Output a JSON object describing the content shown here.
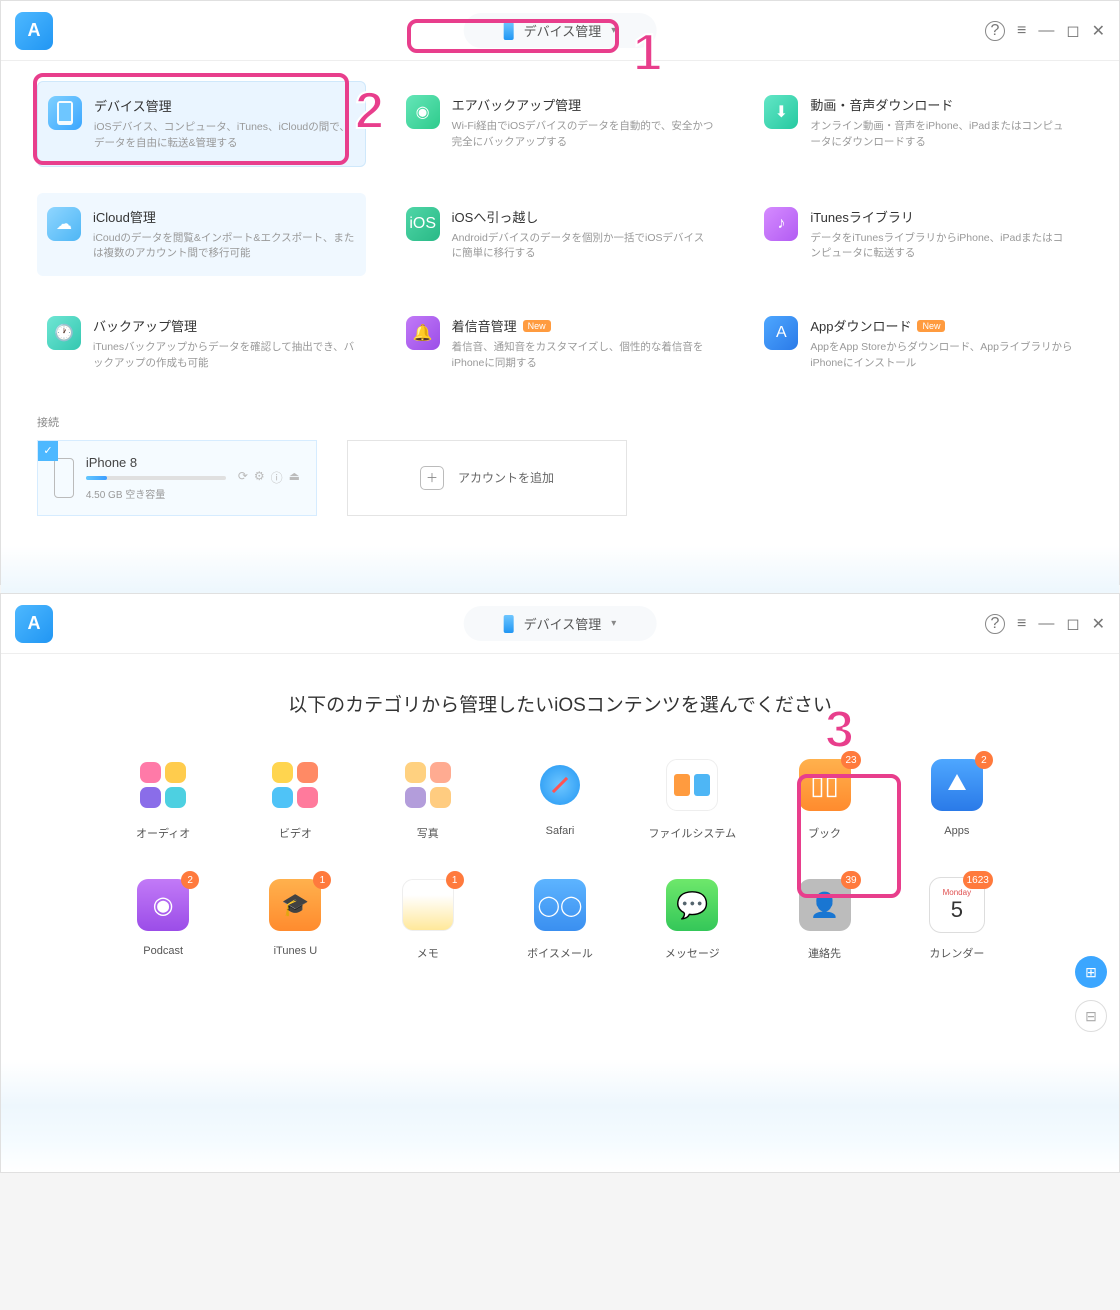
{
  "header": {
    "dropdown_label": "デバイス管理"
  },
  "features": [
    {
      "title": "デバイス管理",
      "desc": "iOSデバイス、コンピュータ、iTunes、iCloudの間で、データを自由に転送&管理する",
      "icon": "phone",
      "color": "linear-gradient(135deg,#7fd0ff,#3ba6ff)",
      "state": "selected"
    },
    {
      "title": "エアバックアップ管理",
      "desc": "Wi-Fi経由でiOSデバイスのデータを自動的で、安全かつ完全にバックアップする",
      "icon": "wifi",
      "color": "linear-gradient(135deg,#65e6b8,#2ecb8c)"
    },
    {
      "title": "動画・音声ダウンロード",
      "desc": "オンライン動画・音声をiPhone、iPadまたはコンピュータにダウンロードする",
      "icon": "download",
      "color": "linear-gradient(135deg,#63e6c6,#25c9a0)"
    },
    {
      "title": "iCloud管理",
      "desc": "iCoudのデータを閲覧&インポート&エクスポート、または複数のアカウント間で移行可能",
      "icon": "cloud",
      "color": "linear-gradient(135deg,#8fd6ff,#4eb6f5)",
      "state": "hover"
    },
    {
      "title": "iOSへ引っ越し",
      "desc": "Androidデバイスのデータを個別か一括でiOSデバイスに簡単に移行する",
      "icon": "ios",
      "color": "linear-gradient(135deg,#4fd6a7,#29b986)"
    },
    {
      "title": "iTunesライブラリ",
      "desc": "データをiTunesライブラリからiPhone、iPadまたはコンピュータに転送する",
      "icon": "music",
      "color": "linear-gradient(135deg,#d58bff,#b25cf3)"
    },
    {
      "title": "バックアップ管理",
      "desc": "iTunesバックアップからデータを確認して抽出でき、バックアップの作成も可能",
      "icon": "clock",
      "color": "linear-gradient(135deg,#6fe6d4,#34c7b0)"
    },
    {
      "title": "着信音管理",
      "desc": "着信音、通知音をカスタマイズし、個性的な着信音をiPhoneに同期する",
      "icon": "bell",
      "color": "linear-gradient(135deg,#c27af7,#9b4de8)",
      "badge": "New"
    },
    {
      "title": "Appダウンロード",
      "desc": "AppをApp Storeからダウンロード、AppライブラリからiPhoneにインストール",
      "icon": "appstore",
      "color": "linear-gradient(135deg,#4ea7ff,#2a7ae8)",
      "badge": "New"
    }
  ],
  "connect_label": "接続",
  "device": {
    "name": "iPhone 8",
    "storage": "4.50 GB 空き容量",
    "fill": 15
  },
  "add_account": "アカウントを追加",
  "window2": {
    "prompt": "以下のカテゴリから管理したいiOSコンテンツを選んでください",
    "categories": [
      {
        "name": "オーディオ",
        "icon": "audio"
      },
      {
        "name": "ビデオ",
        "icon": "video"
      },
      {
        "name": "写真",
        "icon": "photos"
      },
      {
        "name": "Safari",
        "icon": "safari"
      },
      {
        "name": "ファイルシステム",
        "icon": "files"
      },
      {
        "name": "ブック",
        "icon": "books",
        "badge": "23"
      },
      {
        "name": "Apps",
        "icon": "apps",
        "badge": "2",
        "highlight": true
      },
      {
        "name": "Podcast",
        "icon": "podcast",
        "badge": "2"
      },
      {
        "name": "iTunes U",
        "icon": "itunesu",
        "badge": "1"
      },
      {
        "name": "メモ",
        "icon": "notes",
        "badge": "1"
      },
      {
        "name": "ボイスメール",
        "icon": "voicemail"
      },
      {
        "name": "メッセージ",
        "icon": "messages"
      },
      {
        "name": "連絡先",
        "icon": "contacts",
        "badge": "39"
      },
      {
        "name": "カレンダー",
        "icon": "calendar",
        "badge": "1623",
        "cal_month": "Monday",
        "cal_day": "5"
      }
    ]
  },
  "annotations": {
    "one": "1",
    "two": "2",
    "three": "3"
  }
}
